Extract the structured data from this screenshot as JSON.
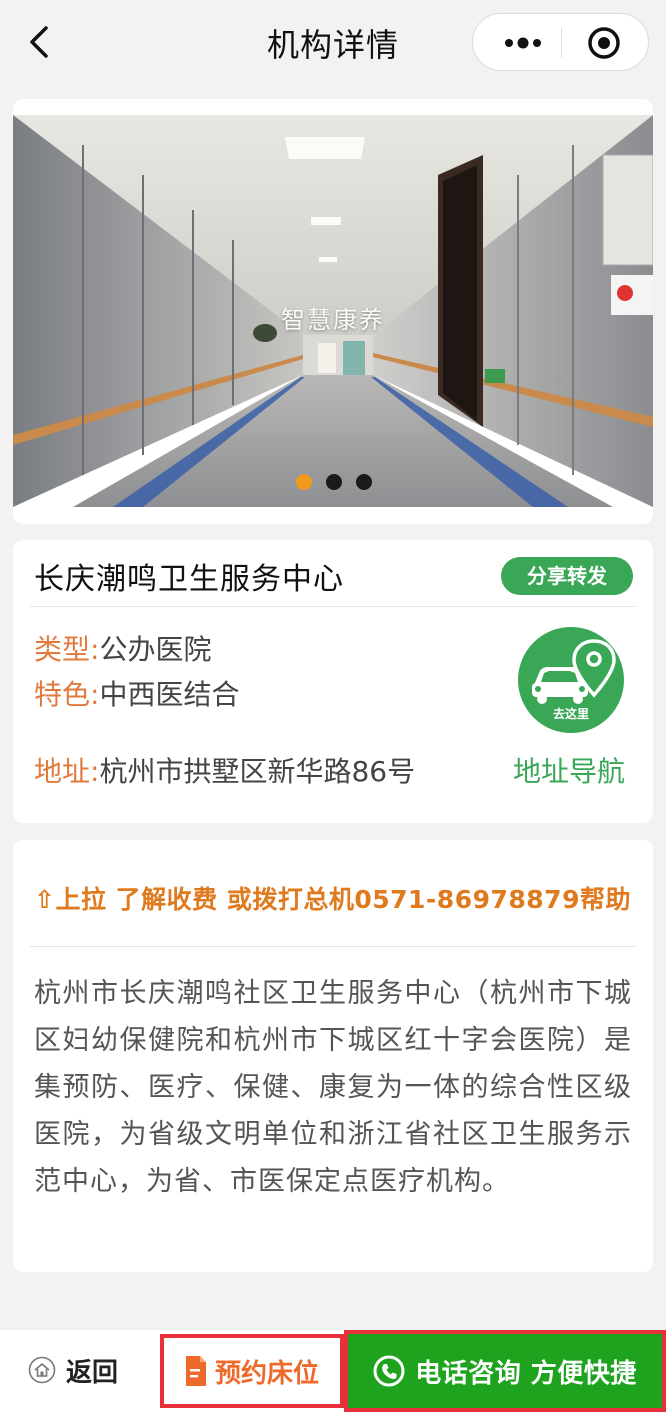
{
  "nav": {
    "title": "机构详情",
    "back_icon": "chevron-left-icon",
    "more_icon": "more-dots-icon",
    "target_icon": "target-icon"
  },
  "banner": {
    "caption": "智慧康养",
    "slide_count": 3,
    "active_slide": 1
  },
  "org": {
    "name": "长庆潮鸣卫生服务中心",
    "share_label": "分享转发",
    "type_key": "类型:",
    "type_value": "公办医院",
    "feature_key": "特色:",
    "feature_value": "中西医结合",
    "address_key": "地址:",
    "address_value": "杭州市拱墅区新华路86号",
    "nav_circle_label": "去这里",
    "nav_link": "地址导航"
  },
  "desc": {
    "hint": "⇧上拉 了解收费 或拨打总机0571-86978879帮助",
    "text": "杭州市长庆潮鸣社区卫生服务中心（杭州市下城区妇幼保健院和杭州市下城区红十字会医院）是集预防、医疗、保健、康复为一体的综合性区级医院，为省级文明单位和浙江省社区卫生服务示范中心，为省、市医保定点医疗机构。"
  },
  "bottom": {
    "back_label": "返回",
    "reserve_label": "预约床位",
    "call_label": "电话咨询 方便快捷"
  },
  "colors": {
    "accent_green": "#3aa757",
    "orange_key": "#e07a3e",
    "call_green": "#1fa31f",
    "highlight_red": "#e8303a"
  }
}
